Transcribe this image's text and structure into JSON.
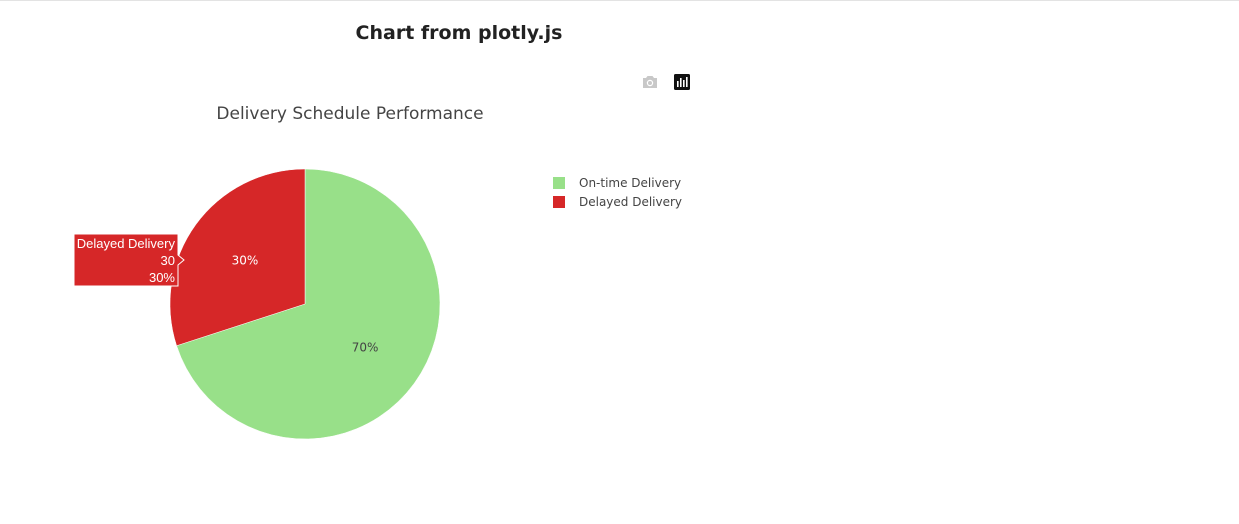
{
  "page": {
    "heading": "Chart from plotly.js"
  },
  "modebar": {
    "items": [
      {
        "icon": "camera-icon",
        "name": "download-plot-button"
      },
      {
        "icon": "plotly-logo-icon",
        "name": "plotly-logo-button"
      }
    ]
  },
  "chart_data": {
    "type": "pie",
    "title": "Delivery Schedule Performance",
    "labels": [
      "On-time Delivery",
      "Delayed Delivery"
    ],
    "values": [
      70,
      30
    ],
    "percent_labels": [
      "70%",
      "30%"
    ],
    "colors": [
      "#98e089",
      "#d62728"
    ],
    "label_colors": [
      "#444444",
      "#ffffff"
    ],
    "legend_position": "right",
    "hover": {
      "label": "Delayed Delivery",
      "value": "30",
      "percent": "30%",
      "color": "#d62728"
    }
  }
}
